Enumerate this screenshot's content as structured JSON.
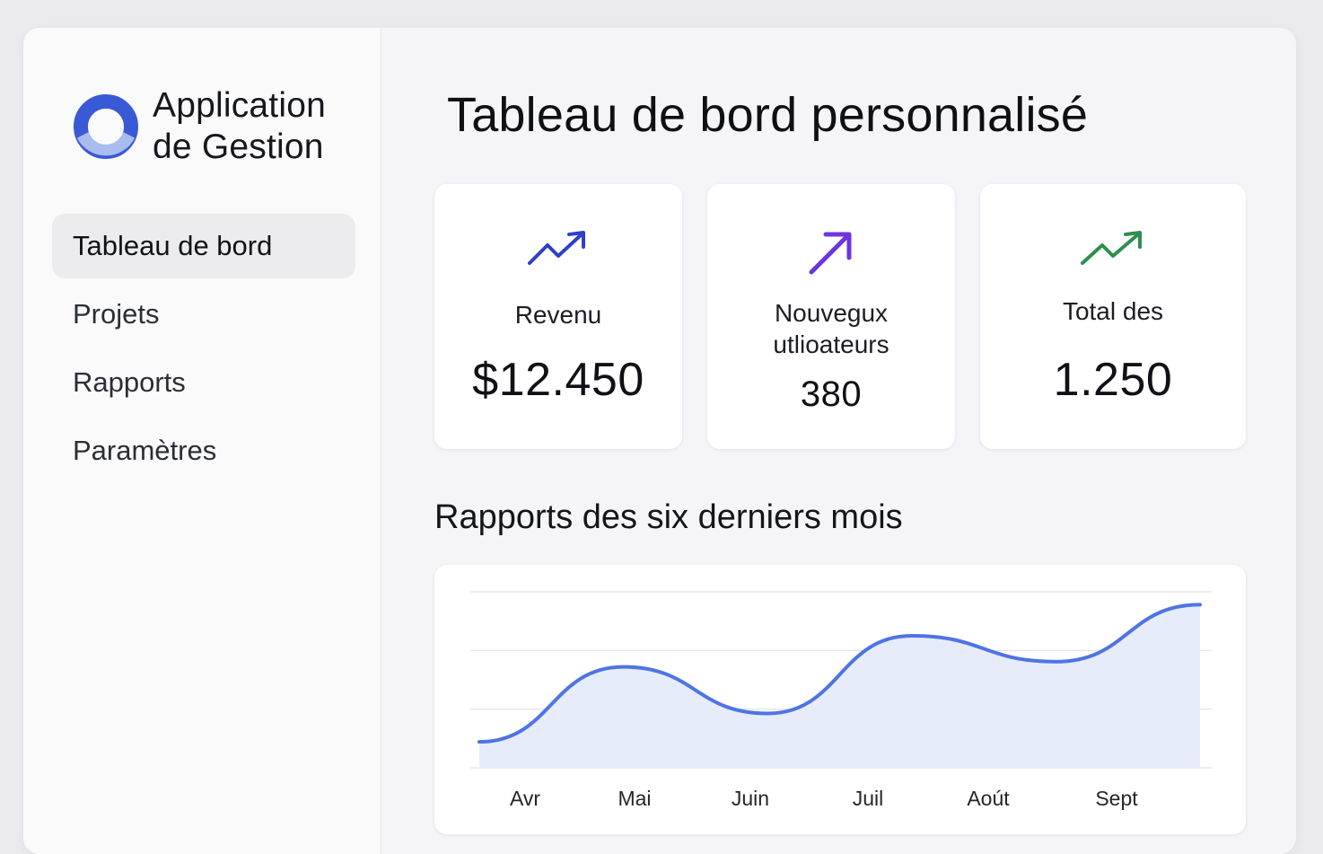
{
  "app": {
    "name_line1": "Application",
    "name_line2": "de Gestion",
    "accent_color": "#3b5bdb"
  },
  "sidebar": {
    "items": [
      {
        "label": "Tableau de bord",
        "active": true
      },
      {
        "label": "Projets",
        "active": false
      },
      {
        "label": "Rapports",
        "active": false
      },
      {
        "label": "Paramètres",
        "active": false
      }
    ]
  },
  "main": {
    "title": "Tableau de bord personnalisé",
    "cards": [
      {
        "label": "Revenu",
        "value": "$12.450",
        "icon": "trending-up-icon",
        "icon_color": "#2f3fc8"
      },
      {
        "label_line1": "Nouvegux",
        "label_line2": "utlioateurs",
        "value": "380",
        "icon": "arrow-up-right-icon",
        "icon_color": "#6d35e0"
      },
      {
        "label": "Total des",
        "value": "1.250",
        "icon": "trending-up-icon",
        "icon_color": "#2f8f4e"
      }
    ],
    "chart_section_title": "Rapports des six derniers mois"
  },
  "chart_data": {
    "type": "area",
    "title": "Rapports des six derniers mois",
    "categories": [
      "Avr",
      "Mai",
      "Juin",
      "Juil",
      "Août",
      "Sept"
    ],
    "x_tick_labels": [
      "Avr",
      "Mai",
      "Juin",
      "Juil",
      "Aoút",
      "Sept"
    ],
    "series": [
      {
        "values": [
          0.5,
          1.95,
          1.05,
          2.55,
          2.05,
          3.15
        ]
      }
    ],
    "ylim": [
      0,
      3.4
    ],
    "grid": true,
    "line_color": "#4f74e3",
    "fill_color": "#e7ecfa"
  }
}
